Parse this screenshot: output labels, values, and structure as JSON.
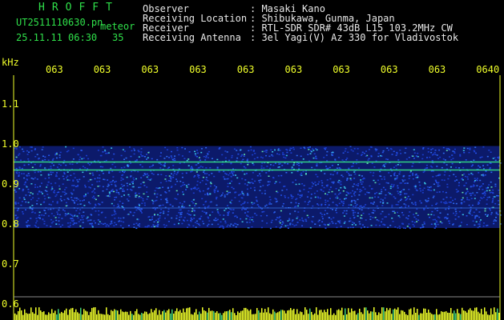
{
  "header": {
    "title": "HROFFT",
    "filename": "UT2511110630.pn",
    "type": "meteor",
    "datetime": "25.11.11 06:30",
    "count": "35",
    "rows": [
      {
        "label": "Observer",
        "value": ": Masaki Kano"
      },
      {
        "label": "Receiving Location",
        "value": ": Shibukawa, Gunma, Japan"
      },
      {
        "label": "Receiver",
        "value": ": RTL-SDR SDR# 43dB L15 103.2MHz CW"
      },
      {
        "label": "Receiving Antenna",
        "value": ": 3el Yagi(V) Az 330 for Vladivostok"
      }
    ]
  },
  "chart_data": {
    "type": "heatmap",
    "ylabel": "kHz",
    "yticks": [
      "1.1",
      "1.0",
      "0.9",
      "0.8",
      "0.7",
      "0.6"
    ],
    "ylim": [
      0.6,
      1.1
    ],
    "xticks": [
      "063",
      "063",
      "063",
      "063",
      "063",
      "063",
      "063",
      "063",
      "063",
      "0640"
    ],
    "band_khz": [
      0.79,
      0.995
    ],
    "lines_khz": [
      0.955,
      0.935,
      0.84
    ],
    "colors": {
      "background": "#000000",
      "noise": "#1b3fd0",
      "signal": "#38f28a",
      "frame": "#f0ff2a"
    }
  }
}
